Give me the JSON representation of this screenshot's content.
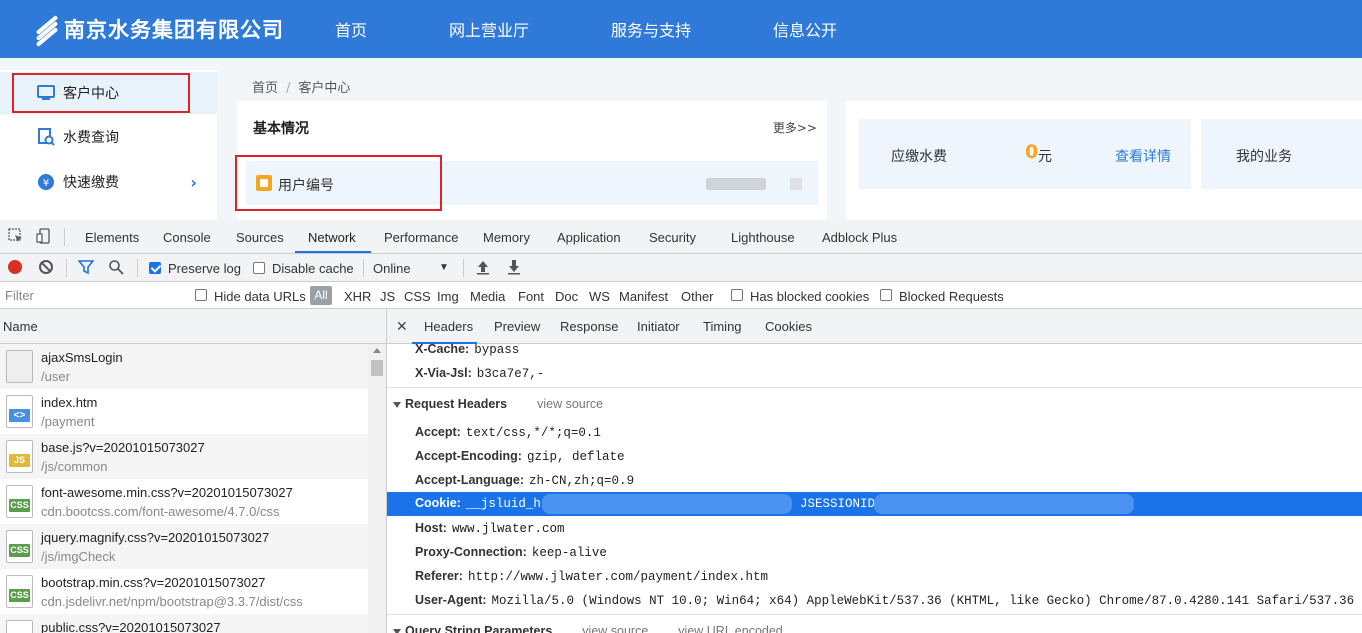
{
  "site": {
    "logo_text": "南京水务集团有限公司",
    "nav": [
      "首页",
      "网上营业厅",
      "服务与支持",
      "信息公开"
    ],
    "sidebar": [
      {
        "label": "客户中心",
        "icon": "monitor-icon"
      },
      {
        "label": "水费查询",
        "icon": "bill-search-icon"
      },
      {
        "label": "快速缴费",
        "icon": "yen-icon"
      }
    ],
    "breadcrumb": {
      "home": "首页",
      "sep": "/",
      "current": "客户中心"
    },
    "basic": {
      "title": "基本情况",
      "more": "更多>>",
      "user_id_label": "用户编号"
    },
    "fee": {
      "label": "应缴水费",
      "amount": "0",
      "unit": "元",
      "link": "查看详情"
    },
    "business": {
      "label": "我的业务"
    },
    "accent": "#2f7ad8",
    "highlight_color": "#e0202a"
  },
  "devtools": {
    "tabs": [
      "Elements",
      "Console",
      "Sources",
      "Network",
      "Performance",
      "Memory",
      "Application",
      "Security",
      "Lighthouse",
      "Adblock Plus"
    ],
    "active_tab": "Network",
    "toolbar": {
      "preserve_log": "Preserve log",
      "disable_cache": "Disable cache",
      "throttle": "Online"
    },
    "filter": {
      "placeholder": "Filter",
      "hide_data_urls": "Hide data URLs",
      "all": "All",
      "types": [
        "XHR",
        "JS",
        "CSS",
        "Img",
        "Media",
        "Font",
        "Doc",
        "WS",
        "Manifest",
        "Other"
      ],
      "has_blocked_cookies": "Has blocked cookies",
      "blocked_requests": "Blocked Requests"
    },
    "list_header": "Name",
    "requests": [
      {
        "name": "ajaxSmsLogin",
        "path": "/user",
        "type": "blank"
      },
      {
        "name": "index.htm",
        "path": "/payment",
        "type": "html"
      },
      {
        "name": "base.js?v=20201015073027",
        "path": "/js/common",
        "type": "js"
      },
      {
        "name": "font-awesome.min.css?v=20201015073027",
        "path": "cdn.bootcss.com/font-awesome/4.7.0/css",
        "type": "css"
      },
      {
        "name": "jquery.magnify.css?v=20201015073027",
        "path": "/js/imgCheck",
        "type": "css"
      },
      {
        "name": "bootstrap.min.css?v=20201015073027",
        "path": "cdn.jsdelivr.net/npm/bootstrap@3.3.7/dist/css",
        "type": "css"
      },
      {
        "name": "public.css?v=20201015073027",
        "path": "",
        "type": "css"
      }
    ],
    "detail_tabs": [
      "Headers",
      "Preview",
      "Response",
      "Initiator",
      "Timing",
      "Cookies"
    ],
    "response_headers_tail": [
      {
        "key": "X-Cache:",
        "value": "bypass"
      },
      {
        "key": "X-Via-Jsl:",
        "value": "b3ca7e7,-"
      }
    ],
    "request_headers": {
      "title": "Request Headers",
      "view_source": "view source",
      "items": [
        {
          "key": "Accept:",
          "value": "text/css,*/*;q=0.1"
        },
        {
          "key": "Accept-Encoding:",
          "value": "gzip, deflate"
        },
        {
          "key": "Accept-Language:",
          "value": "zh-CN,zh;q=0.9"
        },
        {
          "key": "Cookie:",
          "value": "__jsluid_h"
        },
        {
          "key": "Host:",
          "value": "www.jlwater.com"
        },
        {
          "key": "Proxy-Connection:",
          "value": "keep-alive"
        },
        {
          "key": "Referer:",
          "value": "http://www.jlwater.com/payment/index.htm"
        },
        {
          "key": "User-Agent:",
          "value": "Mozilla/5.0 (Windows NT 10.0; Win64; x64) AppleWebKit/537.36 (KHTML, like Gecko) Chrome/87.0.4280.141 Safari/537.36"
        }
      ],
      "cookie_extra": "JSESSIONID="
    },
    "query_section": {
      "title": "Query String Parameters",
      "view_source": "view source",
      "view_url_encoded": "view URL encoded"
    }
  }
}
